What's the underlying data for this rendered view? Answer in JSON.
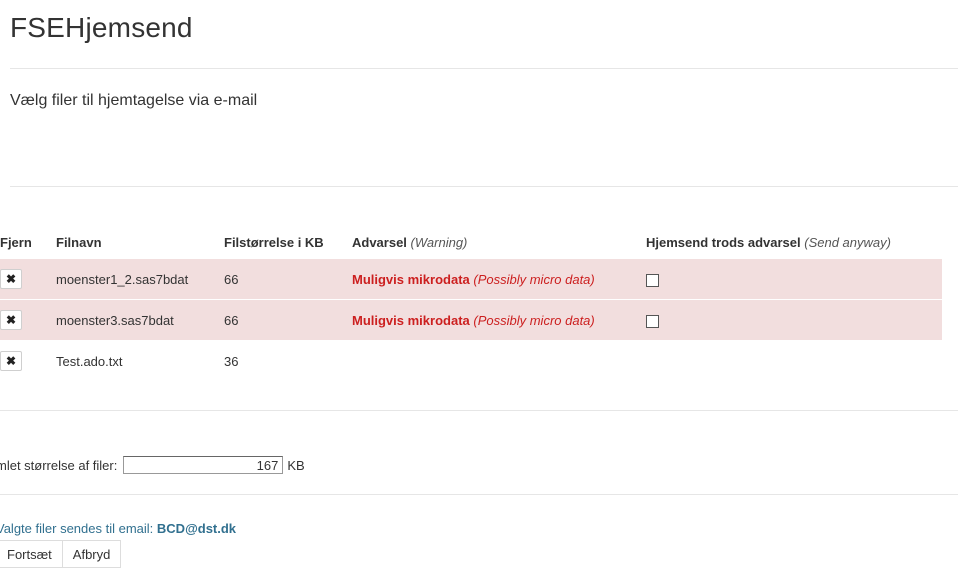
{
  "page": {
    "title": "FSEHjemsend",
    "subtitle": "Vælg filer til hjemtagelse via e-mail"
  },
  "table": {
    "headers": {
      "remove": "Fjern",
      "filename": "Filnavn",
      "size": "Filstørrelse i KB",
      "warning": "Advarsel",
      "warning_en": "(Warning)",
      "send_anyway": "Hjemsend trods advarsel",
      "send_anyway_en": "(Send anyway)"
    },
    "rows": [
      {
        "filename": "moenster1_2.sas7bdat",
        "size": "66",
        "warning": "Muligvis mikrodata",
        "warning_en": "(Possibly micro data)",
        "has_warning": true,
        "send_anyway_checked": false
      },
      {
        "filename": "moenster3.sas7bdat",
        "size": "66",
        "warning": "Muligvis mikrodata",
        "warning_en": "(Possibly micro data)",
        "has_warning": true,
        "send_anyway_checked": false
      },
      {
        "filename": "Test.ado.txt",
        "size": "36",
        "warning": "",
        "warning_en": "",
        "has_warning": false,
        "send_anyway_checked": false
      }
    ],
    "remove_icon": "close-icon",
    "remove_glyph": "✖"
  },
  "total": {
    "label": "mlet størrelse af filer:",
    "value": "167",
    "unit": "KB"
  },
  "email": {
    "text": "Valgte filer sendes til email:",
    "address": "BCD@dst.dk"
  },
  "buttons": {
    "continue": "Fortsæt",
    "cancel": "Afbryd"
  },
  "colors": {
    "warning_row_bg": "#f2dede",
    "warning_text": "#cc1f1f",
    "email_text": "#31708f"
  }
}
